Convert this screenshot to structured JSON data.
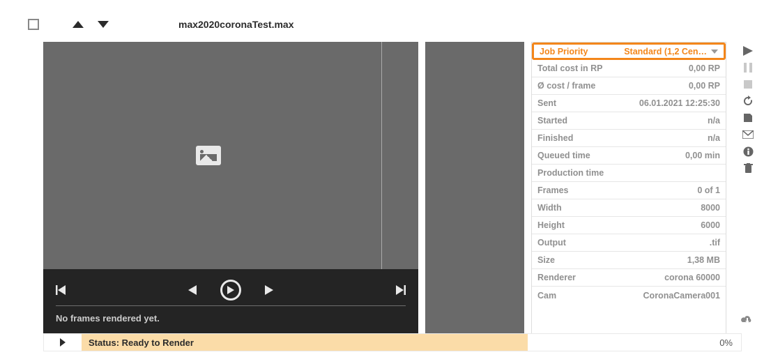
{
  "header": {
    "file_title": "max2020coronaTest.max"
  },
  "preview": {
    "status_text": "No frames rendered yet."
  },
  "props": {
    "priority_label": "Job Priority",
    "priority_value": "Standard (1,2 Cen…",
    "total_cost_label": "Total cost in RP",
    "total_cost_value": "0,00 RP",
    "avg_cost_label": "Ø cost / frame",
    "avg_cost_value": "0,00 RP",
    "sent_label": "Sent",
    "sent_value": "06.01.2021 12:25:30",
    "started_label": "Started",
    "started_value": "n/a",
    "finished_label": "Finished",
    "finished_value": "n/a",
    "queued_label": "Queued time",
    "queued_value": "0,00 min",
    "production_label": "Production time",
    "production_value": "",
    "frames_label": "Frames",
    "frames_value": "0 of 1",
    "width_label": "Width",
    "width_value": "8000",
    "height_label": "Height",
    "height_value": "6000",
    "output_label": "Output",
    "output_value": ".tif",
    "size_label": "Size",
    "size_value": "1,38 MB",
    "renderer_label": "Renderer",
    "renderer_value": "corona 60000",
    "cam_label": "Cam",
    "cam_value": "CoronaCamera001"
  },
  "status": {
    "text": "Status: Ready to Render",
    "progress": "0%"
  }
}
